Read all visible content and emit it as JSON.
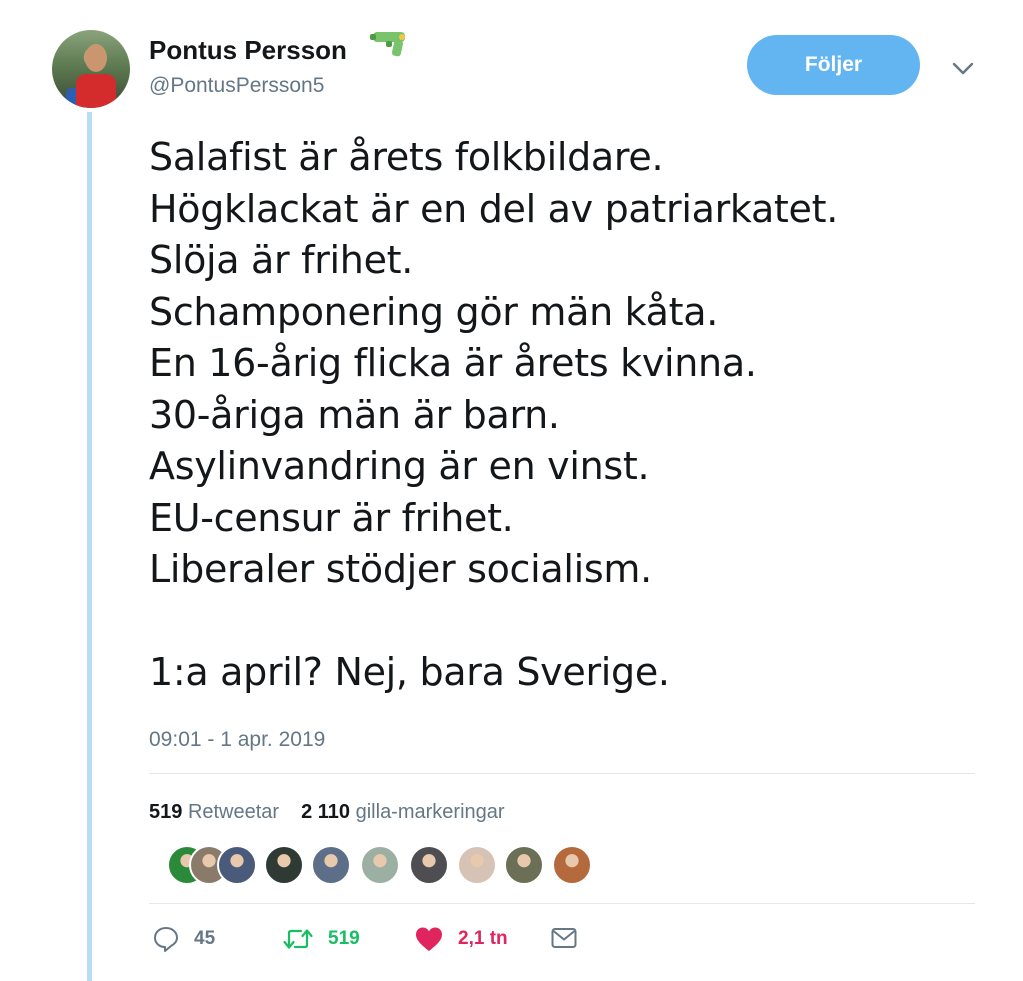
{
  "author": {
    "name": "Pontus Persson",
    "name_emoji": "water-pistol-icon",
    "handle": "@PontusPersson5"
  },
  "follow_button": {
    "label": "Följer",
    "color": "#63b5f1"
  },
  "menu": {
    "icon": "chevron-down-icon"
  },
  "tweet": {
    "lines": [
      "Salafist är årets folkbildare.",
      "Högklackat är en del av patriarkatet.",
      "Slöja är frihet.",
      "Schamponering gör män kåta.",
      "En 16-årig flicka är årets kvinna.",
      "30-åriga män är barn.",
      "Asylinvandring är en vinst.",
      "EU-censur är frihet.",
      "Liberaler stödjer socialism.",
      "",
      "1:a april? Nej, bara Sverige."
    ],
    "timestamp": "09:01 - 1 apr. 2019"
  },
  "stats": {
    "retweets": {
      "count": "519",
      "label": "Retweetar"
    },
    "likes": {
      "count": "2 110",
      "label": "gilla-markeringar"
    }
  },
  "likers": [
    {
      "color": "#2a8a3a"
    },
    {
      "color": "#8a7a6a"
    },
    {
      "color": "#4a5a7a"
    },
    {
      "color": "#2f3a35"
    },
    {
      "color": "#5d6f88"
    },
    {
      "color": "#9bb0a2"
    },
    {
      "color": "#4e4e52"
    },
    {
      "color": "#d7c3b6"
    },
    {
      "color": "#6a6f55"
    },
    {
      "color": "#b46a3c"
    }
  ],
  "actions": {
    "reply": {
      "icon": "reply-icon",
      "count": "45"
    },
    "retweet": {
      "icon": "retweet-icon",
      "count": "519",
      "color": "#17bf63"
    },
    "like": {
      "icon": "heart-icon",
      "count": "2,1 tn",
      "color": "#e0245e"
    },
    "message": {
      "icon": "envelope-icon"
    }
  }
}
